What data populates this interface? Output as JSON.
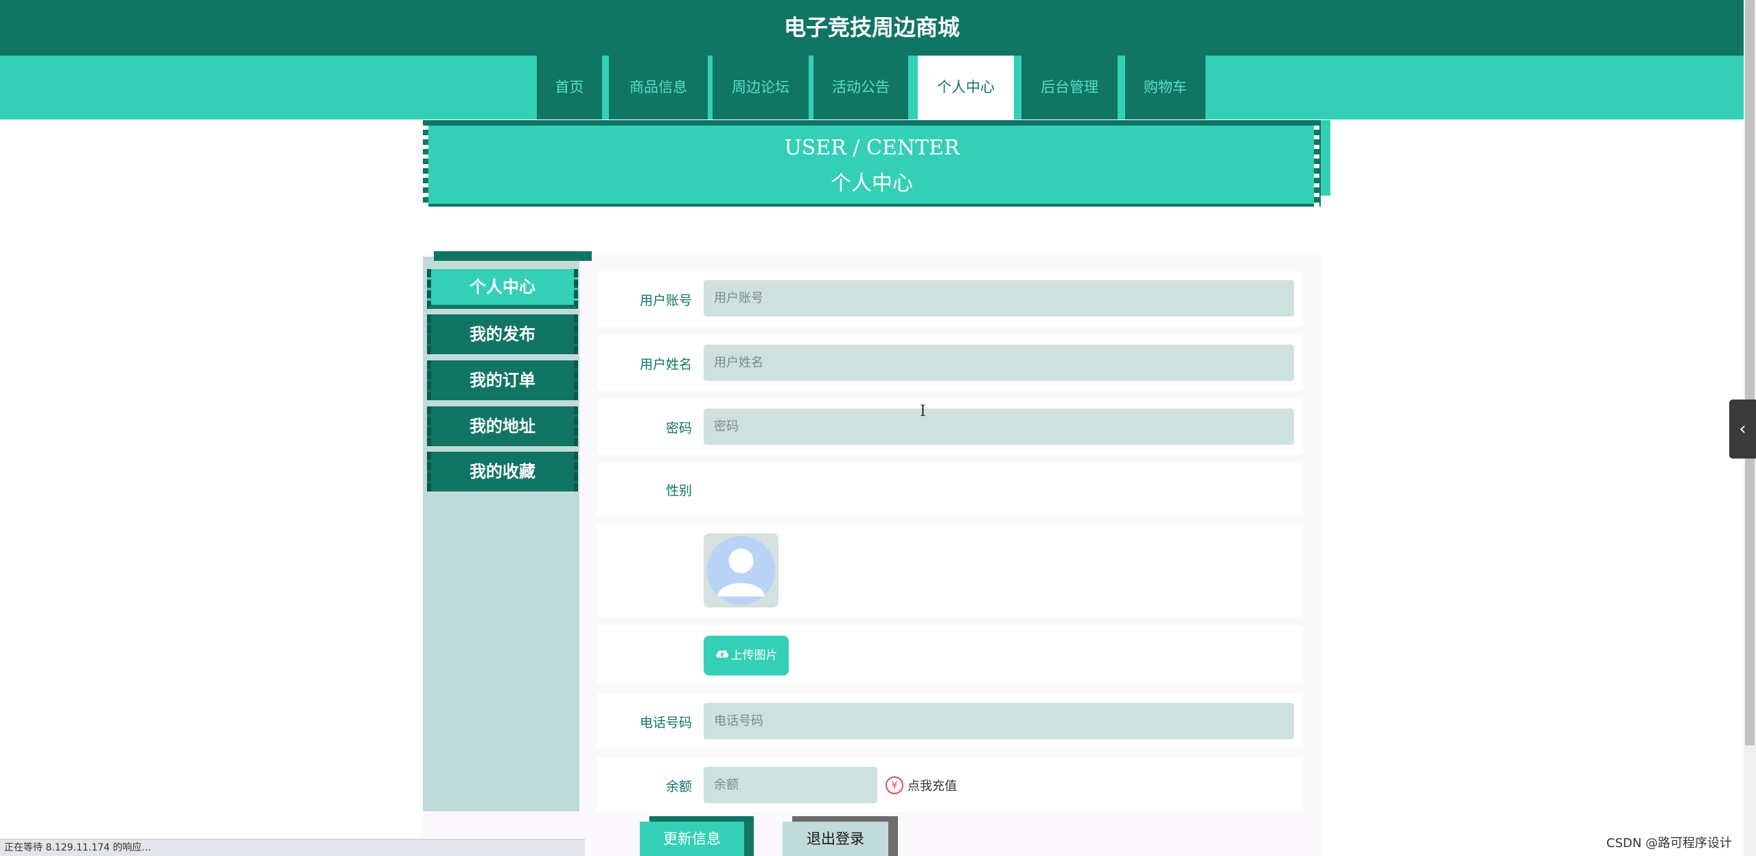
{
  "site": {
    "title": "电子竞技周边商城"
  },
  "nav": {
    "items": [
      {
        "label": "首页",
        "active": false
      },
      {
        "label": "商品信息",
        "active": false
      },
      {
        "label": "周边论坛",
        "active": false
      },
      {
        "label": "活动公告",
        "active": false
      },
      {
        "label": "个人中心",
        "active": true
      },
      {
        "label": "后台管理",
        "active": false
      },
      {
        "label": "购物车",
        "active": false
      }
    ]
  },
  "banner": {
    "en": "USER / CENTER",
    "cn": "个人中心"
  },
  "sidebar": {
    "items": [
      {
        "label": "个人中心",
        "active": true
      },
      {
        "label": "我的发布",
        "active": false
      },
      {
        "label": "我的订单",
        "active": false
      },
      {
        "label": "我的地址",
        "active": false
      },
      {
        "label": "我的收藏",
        "active": false
      }
    ]
  },
  "form": {
    "username": {
      "label": "用户账号",
      "placeholder": "用户账号"
    },
    "realname": {
      "label": "用户姓名",
      "placeholder": "用户姓名"
    },
    "password": {
      "label": "密码",
      "placeholder": "密码"
    },
    "gender": {
      "label": "性别"
    },
    "upload_label": "上传图片",
    "phone": {
      "label": "电话号码",
      "placeholder": "电话号码"
    },
    "balance": {
      "label": "余额",
      "placeholder": "余额"
    },
    "recharge_label": "点我充值",
    "recharge_icon": "¥",
    "update_label": "更新信息",
    "logout_label": "退出登录"
  },
  "browser": {
    "status_text": "正在等待 8.129.11.174 的响应...",
    "watermark": "CSDN @路可程序设计"
  },
  "colors": {
    "primary_dark": "#117564",
    "primary_light": "#33d0b6",
    "field_bg": "#cfe1df",
    "sidebar_bg": "#c0dbd8",
    "recharge_red": "#e74a5a"
  },
  "icons": {
    "upload": "cloud-upload-icon",
    "avatar": "user-avatar-icon",
    "recharge": "yen-icon",
    "collapse": "chevron-left-icon"
  }
}
